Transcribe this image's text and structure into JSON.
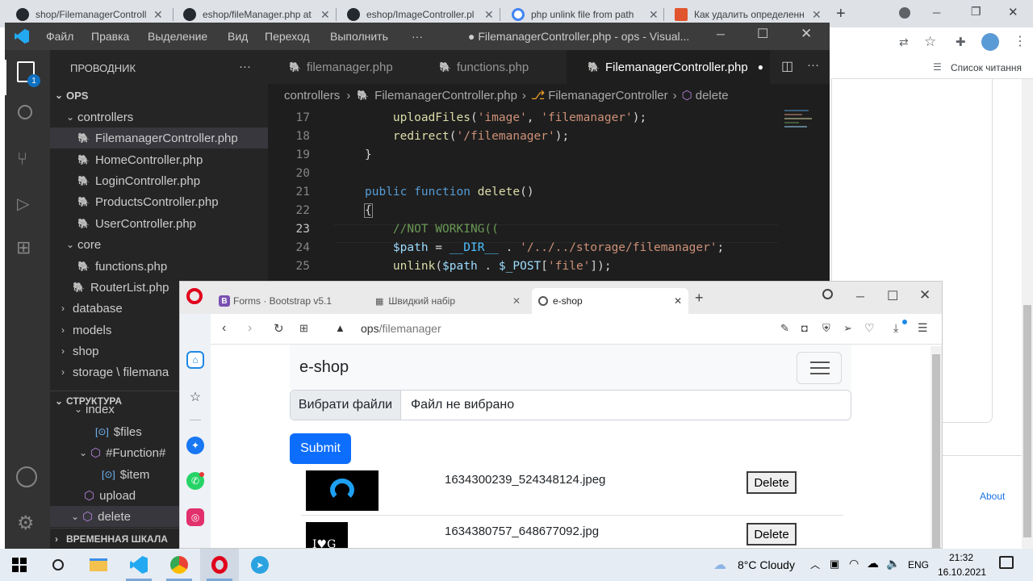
{
  "chrome": {
    "tabs": [
      {
        "title": "shop/FilemanagerControll",
        "icon_color": "#24292f"
      },
      {
        "title": "eshop/fileManager.php at",
        "icon_color": "#24292f"
      },
      {
        "title": "eshop/ImageController.pl",
        "icon_color": "#24292f"
      },
      {
        "title": "php unlink file from path",
        "icon_color": "#4285f4"
      },
      {
        "title": "Как удалить определенн",
        "icon_color": "#e0542e"
      }
    ],
    "reading_list": "Список читання",
    "about": "About"
  },
  "vscode": {
    "menu": [
      "Файл",
      "Правка",
      "Выделение",
      "Вид",
      "Переход",
      "Выполнить",
      "···"
    ],
    "window_title": "● FilemanagerController.php - ops - Visual...",
    "explorer_title": "ПРОВОДНИК",
    "explorer_more": "···",
    "badge": "1",
    "tree": {
      "root": "OPS",
      "controllers": "controllers",
      "controller_files": [
        "FilemanagerController.php",
        "HomeController.php",
        "LoginController.php",
        "ProductsController.php",
        "UserController.php"
      ],
      "core": "core",
      "core_files": [
        "functions.php",
        "RouterList.php"
      ],
      "folders": [
        "database",
        "models",
        "shop",
        "storage \\ filemana"
      ]
    },
    "outline": {
      "title": "СТРУКТУРА",
      "items": [
        "index",
        "$files",
        "#Function#",
        "$item",
        "upload",
        "delete"
      ],
      "timeline": "ВРЕМЕННАЯ ШКАЛА"
    },
    "tabs": [
      "filemanager.php",
      "functions.php",
      "FilemanagerController.php"
    ],
    "breadcrumb": [
      "controllers",
      "FilemanagerController.php",
      "FilemanagerController",
      "delete"
    ],
    "line_numbers": [
      "17",
      "18",
      "19",
      "20",
      "21",
      "22",
      "23",
      "24",
      "25"
    ]
  },
  "opera": {
    "tabs": [
      "Forms · Bootstrap v5.1",
      "Швидкий набір",
      "e-shop"
    ],
    "url_host": "ops",
    "url_path": "/filemanager"
  },
  "page": {
    "brand": "e-shop",
    "file_button": "Вибрати файли",
    "file_status": "Файл не вибрано",
    "submit": "Submit",
    "files": [
      {
        "name": "1634300239_524348124.jpeg",
        "delete": "Delete"
      },
      {
        "name": "1634380757_648677092.jpg",
        "delete": "Delete"
      }
    ]
  },
  "taskbar": {
    "weather": "8°C  Cloudy",
    "lang": "ENG",
    "time": "21:32",
    "date": "16.10.2021"
  }
}
